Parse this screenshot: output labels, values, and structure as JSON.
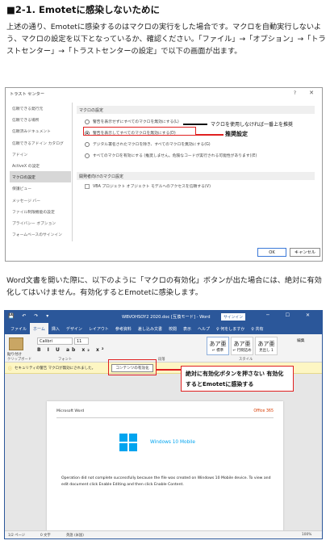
{
  "heading": "■2-1. Emotetに感染しないために",
  "para1": "上述の通り、Emotetに感染するのはマクロの実行をした場合です。マクロを自動実行しないよう、マクロの設定を以下となっているか、確認ください。「ファイル」→「オプション」→「トラストセンター」→「トラストセンターの設定」で以下の画面が出ます。",
  "para2": "Word文書を開いた際に、以下のように「マクロの有効化」ボタンが出た場合には、絶対に有効化してはいけません。有効化するとEmotetに感染します。",
  "trust_dialog": {
    "title": "トラスト センター",
    "help": "?",
    "close": "✕",
    "nav": [
      "信頼できる発行元",
      "信頼できる場所",
      "信頼済みドキュメント",
      "信頼できるアドイン カタログ",
      "アドイン",
      "ActiveX の設定",
      "マクロの設定",
      "保護ビュー",
      "メッセージ バー",
      "ファイル制限機能の設定",
      "プライバシー オプション",
      "フォームベースのサインイン"
    ],
    "selected_nav": "マクロの設定",
    "section1": "マクロの設定",
    "options": [
      "警告を表示せずにすべてのマクロを無効にする(L)",
      "警告を表示してすべてのマクロを無効にする(D)",
      "デジタル署名されたマクロを除き、すべてのマクロを無効にする(G)",
      "すべてのマクロを有効にする (推奨しません。危険なコードが実行される可能性があります)(E)"
    ],
    "section2": "開発者向けのマクロ設定",
    "vba_option": "VBA プロジェクト オブジェクト モデルへのアクセスを信頼する(V)",
    "annotation1": "マクロを使用しなければ一番上を推奨",
    "annotation2": "推奨設定",
    "ok": "OK",
    "cancel": "キャンセル"
  },
  "word": {
    "qat": "💾 ↶ ↷ ▾",
    "title": "WBVOHSOY2 2020.doc [互換モード] - Word",
    "signin": "サインイン",
    "controls": "─ ☐ ✕",
    "tabs": [
      "ファイル",
      "ホーム",
      "挿入",
      "デザイン",
      "レイアウト",
      "参考資料",
      "差し込み文書",
      "校閲",
      "表示",
      "ヘルプ",
      "♀ 何をしますか",
      "♀ 共有"
    ],
    "active_tab": "ホーム",
    "paste": "貼り付け",
    "font": "Calibri",
    "size": "11",
    "format_row": "B I U ab x₂ x²",
    "styles": [
      {
        "big": "あア亜",
        "label": "↵ 標準"
      },
      {
        "big": "あア亜",
        "label": "↵ 行間詰め"
      },
      {
        "big": "あア亜",
        "label": "見出し 1"
      }
    ],
    "edit": "編集",
    "groups": [
      "クリップボード",
      "フォント",
      "段落",
      "スタイル"
    ],
    "msg_text": "セキュリティの警告 マクロが無効にされました。",
    "msg_button": "コンテンツの有効化",
    "callout": "絶対に有効化ボタンを押さない 有効化するとEmotetに感染する",
    "doc_header": "Microsoft Word",
    "doc_office": "Office 365",
    "doc_logo_text": "Windows 10 Mobile",
    "doc_msg": "Operation did not complete successfully because the file was created on Windows 10 Mobile device. To view and edit document click Enable Editing and then click Enable Content.",
    "status_page": "1/2 ページ",
    "status_words": "0 文字",
    "status_lang": "英語 (米国)",
    "status_zoom": "100%"
  }
}
